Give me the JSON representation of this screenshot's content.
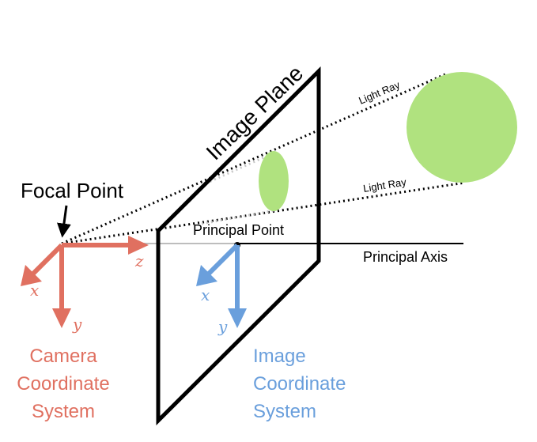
{
  "labels": {
    "focal_point": "Focal Point",
    "image_plane": "Image Plane",
    "principal_point": "Principal Point",
    "principal_axis": "Principal Axis",
    "light_ray_top": "Light Ray",
    "light_ray_bottom": "Light Ray"
  },
  "camera_axes": {
    "x": "x",
    "y": "y",
    "z": "z",
    "title_line1": "Camera",
    "title_line2": "Coordinate",
    "title_line3": "System"
  },
  "image_axes": {
    "x": "x",
    "y": "y",
    "title_line1": "Image",
    "title_line2": "Coordinate",
    "title_line3": "System"
  },
  "colors": {
    "camera": "#e07060",
    "image": "#6a9fdc",
    "object": "#b0e27f",
    "line": "#000000",
    "axis_gray": "#bdbdbd"
  }
}
